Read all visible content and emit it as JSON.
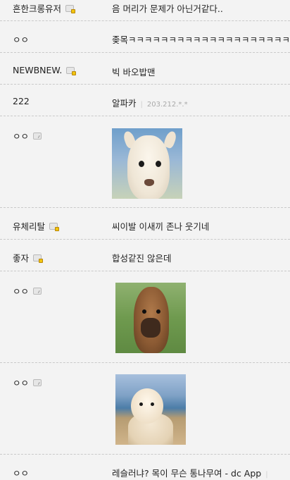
{
  "rows": [
    {
      "nick": "흔한크롱유저",
      "text": "음 머리가 문제가 아닌거같다.."
    },
    {
      "nick": "ㅇㅇ",
      "text": "좆목ㅋㅋㅋㅋㅋㅋㅋㅋㅋㅋㅋㅋㅋㅋㅋㅋㅋㅋㅋㅋㅋ"
    },
    {
      "nick": "NEWBNEW.",
      "text": "빅 바오밥맨"
    },
    {
      "nick": "222",
      "text": "알파카",
      "meta": "203.212.*.*"
    },
    {
      "nick": "ㅇㅇ"
    },
    {
      "nick": "유체리탈",
      "text": "씨이발 이새끼 존나 웃기네"
    },
    {
      "nick": "좋자",
      "text": "합성같진 않은데"
    },
    {
      "nick": "ㅇㅇ"
    },
    {
      "nick": "ㅇㅇ"
    },
    {
      "nick": "ㅇㅇ",
      "text": "레슬러냐? 목이 무슨 통나무여 - dc App"
    }
  ],
  "icons": {
    "gold_badge": "member-badge-icon",
    "plain_badge": "guest-badge-icon"
  },
  "colors": {
    "background": "#f3f3f3",
    "divider": "#c9c9c9",
    "meta_text": "#a9a9a9"
  }
}
